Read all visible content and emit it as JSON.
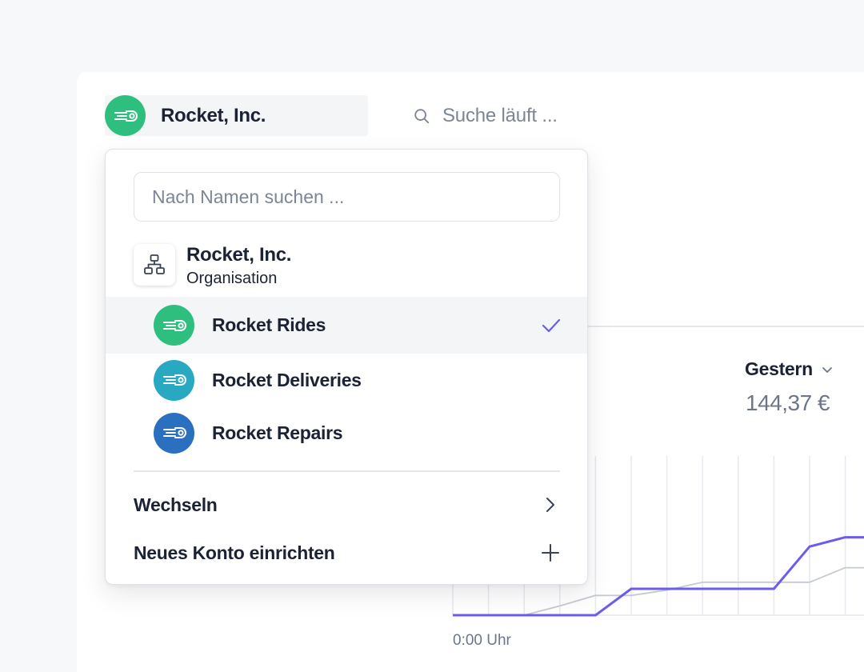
{
  "header": {
    "account_name": "Rocket, Inc.",
    "account_color": "#2ebf7f",
    "search_text": "Suche läuft ..."
  },
  "metric": {
    "label": "Gestern",
    "value": "144,37 €"
  },
  "chart_data": {
    "type": "line",
    "x_start_label": "0:00 Uhr",
    "series": [
      {
        "color": "#6b5cf0",
        "values": [
          0,
          0,
          0,
          0,
          0,
          1,
          1,
          1,
          1,
          1,
          2.6,
          2.95,
          2.95
        ]
      },
      {
        "color": "#c5cad2",
        "values": [
          0,
          0,
          0,
          0.35,
          0.75,
          0.75,
          0.95,
          1.25,
          1.25,
          1.25,
          1.25,
          1.8,
          1.8
        ]
      }
    ]
  },
  "dropdown": {
    "search_placeholder": "Nach Namen suchen ...",
    "org": {
      "name": "Rocket, Inc.",
      "type": "Organisation"
    },
    "accounts": [
      {
        "label": "Rocket Rides",
        "color": "#2ebf7f",
        "selected": true
      },
      {
        "label": "Rocket Deliveries",
        "color": "#29a8c2",
        "selected": false
      },
      {
        "label": "Rocket Repairs",
        "color": "#2a6fc0",
        "selected": false
      }
    ],
    "switch_label": "Wechseln",
    "new_account_label": "Neues Konto einrichten",
    "check_color": "#6b5cf0"
  }
}
